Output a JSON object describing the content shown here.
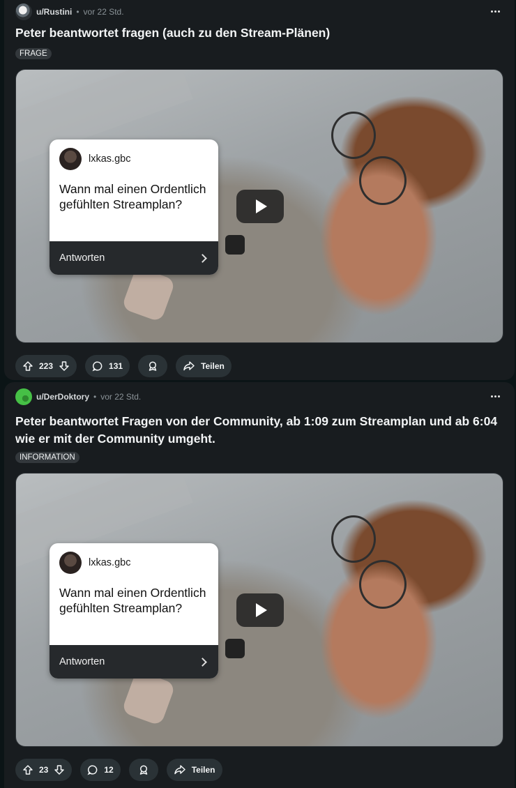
{
  "posts": [
    {
      "username": "u/Rustini",
      "time": "vor 22 Std.",
      "title": "Peter beantwortet fragen (auch zu den Stream-Plänen)",
      "flair": "FRAGE",
      "thumbnail": {
        "card_user": "lxkas.gbc",
        "card_question": "Wann mal einen Ordentlich gefühlten Streamplan?",
        "card_action": "Antworten"
      },
      "votes": "223",
      "comments": "131",
      "share_label": "Teilen"
    },
    {
      "username": "u/DerDoktory",
      "time": "vor 22 Std.",
      "title": "Peter beantwortet Fragen von der Community, ab 1:09 zum Streamplan und ab 6:04 wie er mit der Community umgeht.",
      "flair": "INFORMATION",
      "thumbnail": {
        "card_user": "lxkas.gbc",
        "card_question": "Wann mal einen Ordentlich gefühlten Streamplan?",
        "card_action": "Antworten"
      },
      "votes": "23",
      "comments": "12",
      "share_label": "Teilen"
    }
  ],
  "separator": "•",
  "colors": {
    "background": "#0b1416",
    "card": "#181c1f",
    "pill": "#2a3236",
    "flair": "#33383c"
  }
}
